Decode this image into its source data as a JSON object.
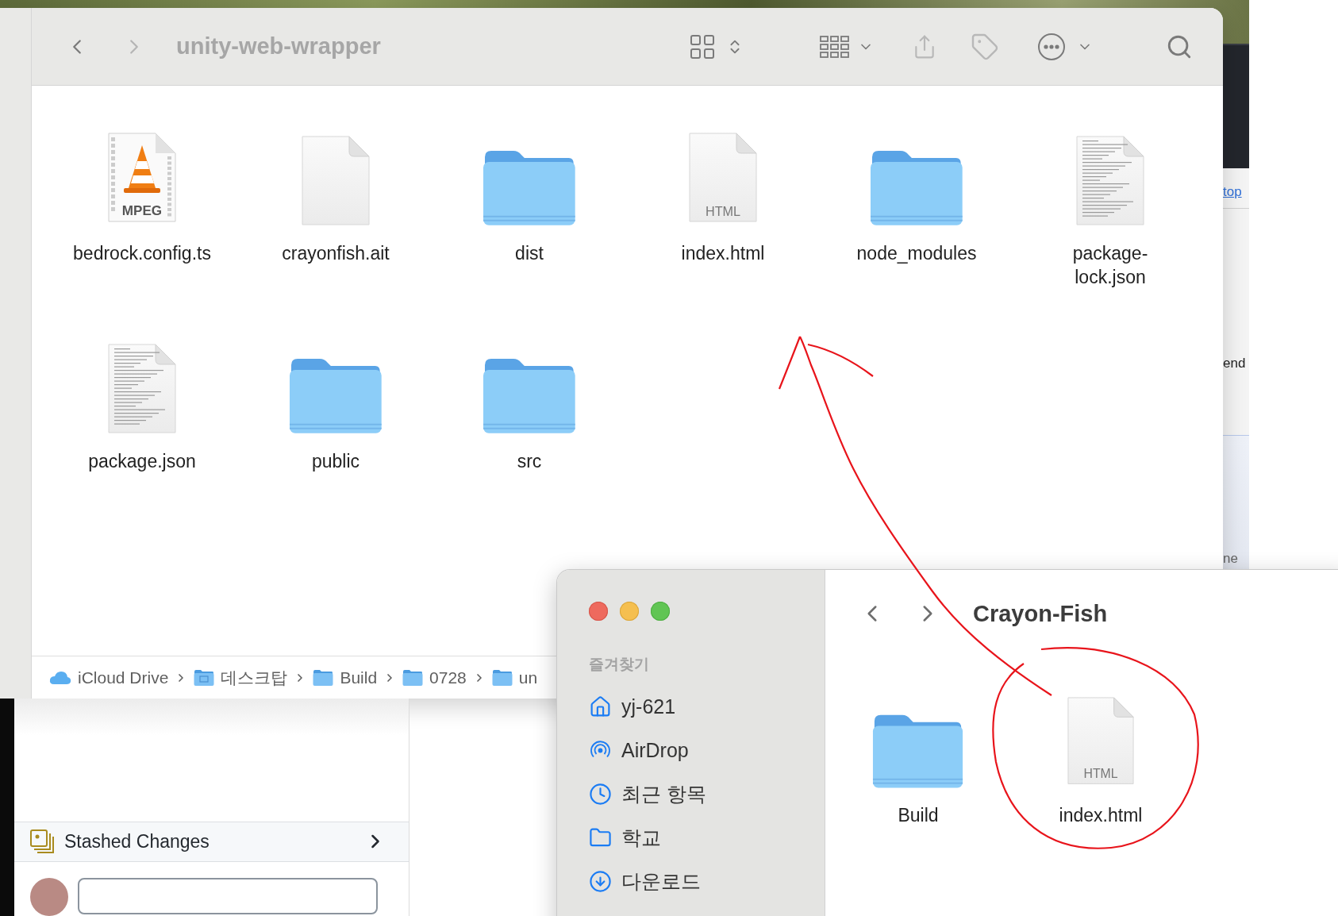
{
  "background_window": {
    "link": "top",
    "texts": [
      "end",
      "ne"
    ]
  },
  "finder_main": {
    "title": "unity-web-wrapper",
    "items": [
      {
        "name": "bedrock.config.ts",
        "kind": "vlc",
        "badge": "MPEG"
      },
      {
        "name": "crayonfish.ait",
        "kind": "blank"
      },
      {
        "name": "dist",
        "kind": "folder"
      },
      {
        "name": "index.html",
        "kind": "html",
        "badge": "HTML"
      },
      {
        "name": "node_modules",
        "kind": "folder"
      },
      {
        "name": "package-lock.json",
        "kind": "text"
      },
      {
        "name": "package.json",
        "kind": "text"
      },
      {
        "name": "public",
        "kind": "folder"
      },
      {
        "name": "src",
        "kind": "folder"
      }
    ],
    "path": [
      {
        "label": "iCloud Drive",
        "kind": "cloud"
      },
      {
        "label": "데스크탑",
        "kind": "desktop"
      },
      {
        "label": "Build",
        "kind": "folder"
      },
      {
        "label": "0728",
        "kind": "folder"
      },
      {
        "label": "un",
        "kind": "folder"
      }
    ]
  },
  "git_panel": {
    "stashed": "Stashed Changes"
  },
  "finder_front": {
    "sidebar_heading": "즐겨찾기",
    "sidebar": [
      {
        "label": "yj-621",
        "kind": "home"
      },
      {
        "label": "AirDrop",
        "kind": "airdrop"
      },
      {
        "label": "최근 항목",
        "kind": "recent"
      },
      {
        "label": "학교",
        "kind": "folder"
      },
      {
        "label": "다운로드",
        "kind": "download"
      }
    ],
    "title": "Crayon-Fish",
    "items": [
      {
        "name": "Build",
        "kind": "folder"
      },
      {
        "name": "index.html",
        "kind": "html",
        "badge": "HTML"
      }
    ]
  }
}
